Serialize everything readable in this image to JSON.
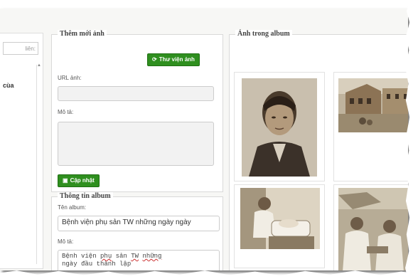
{
  "sidebar": {
    "search_placeholder": "liên:",
    "item_label": "cùa"
  },
  "add_photo": {
    "legend": "Thêm mới ảnh",
    "library_button": "Thư viện ảnh",
    "url_label": "URL ảnh:",
    "url_value": "",
    "desc_label": "Mô tả:",
    "desc_value": "",
    "update_button": "Cập nhật"
  },
  "album_info": {
    "legend": "Thông tin album",
    "name_label": "Tên album:",
    "name_value": "Bệnh viện phụ sản TW những ngày ngày",
    "desc_label": "Mô tả:",
    "desc_line1_a": "Bệnh viện ",
    "desc_line1_b": "phụ",
    "desc_line1_c": " sản ",
    "desc_line1_d": "TW",
    "desc_line1_e": " ",
    "desc_line1_f": "những",
    "desc_line2": "ngày đầu thành lập"
  },
  "album": {
    "legend": "Ảnh trong album"
  }
}
